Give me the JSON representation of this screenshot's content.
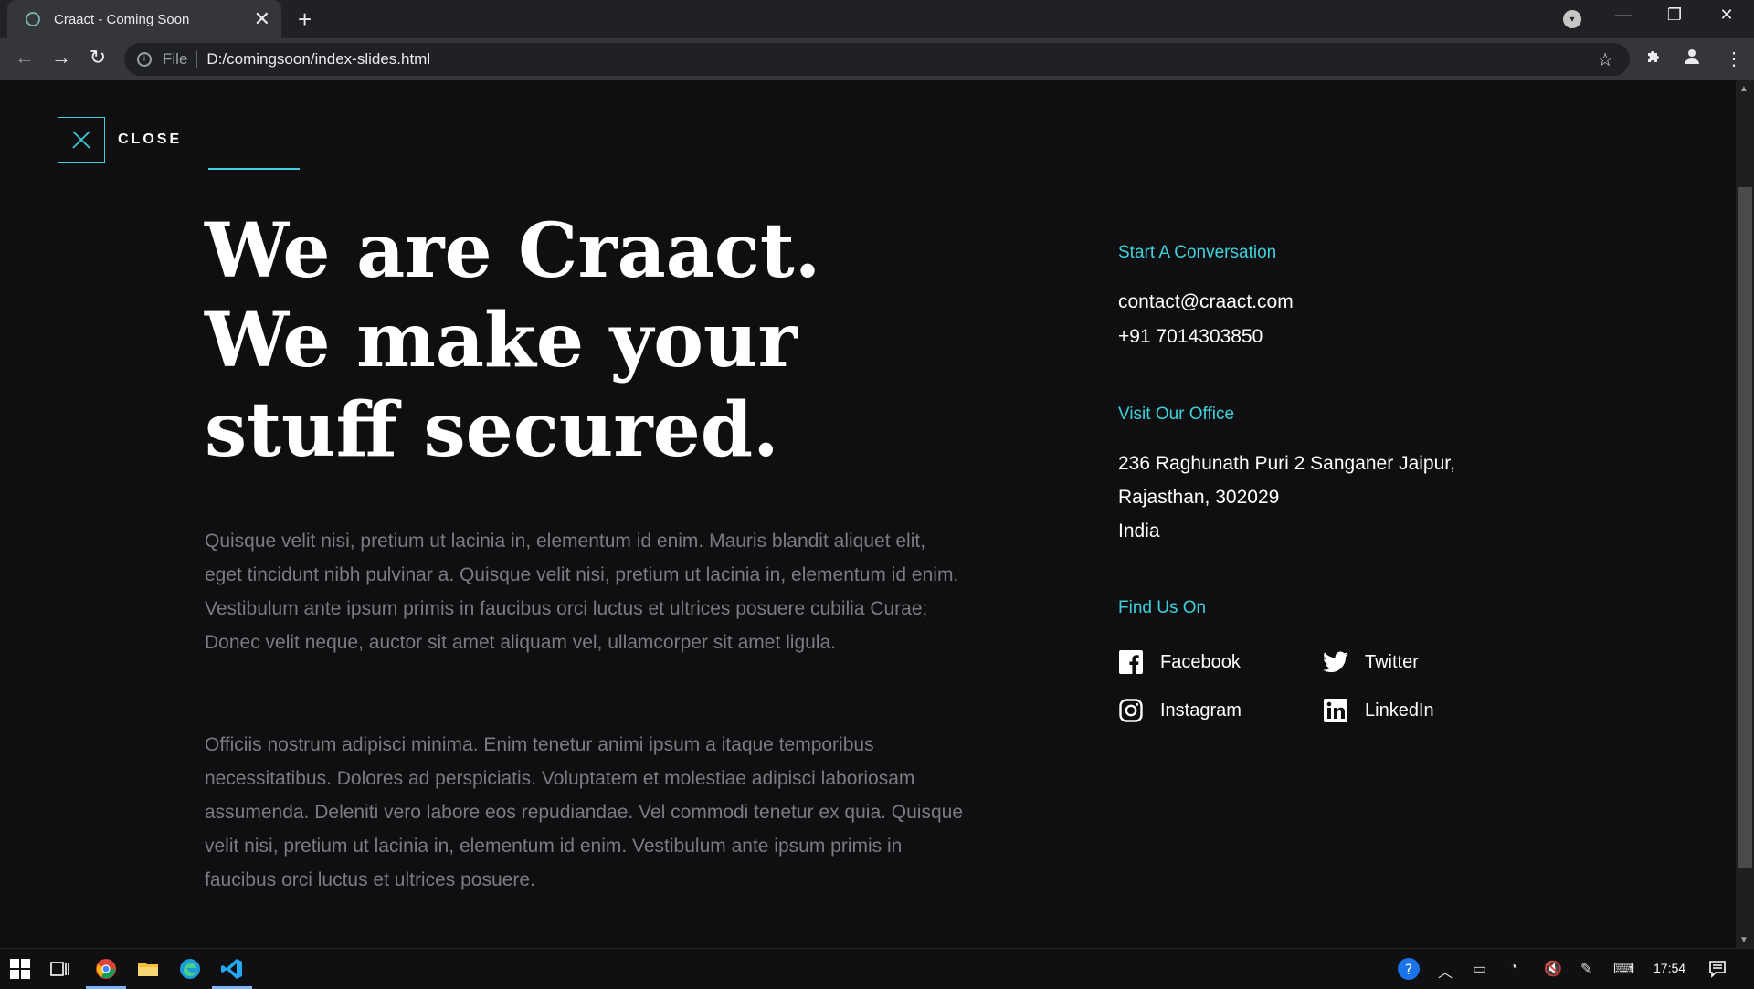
{
  "browser": {
    "tab_title": "Craact - Coming Soon",
    "tab_close": "✕",
    "new_tab": "+",
    "address_scheme": "File",
    "address_url": "D:/comingsoon/index-slides.html",
    "bookmark_icon": "☆",
    "extensions_icon": "puzzle-icon",
    "window": {
      "minimize": "—",
      "restore": "❐",
      "close": "✕"
    },
    "nav": {
      "back": "←",
      "forward": "→",
      "reload": "↻",
      "more": "⋮"
    }
  },
  "page": {
    "close_label": "CLOSE",
    "headline": "We are Craact. We make your stuff secured.",
    "paragraph_1": "Quisque velit nisi, pretium ut lacinia in, elementum id enim. Mauris blandit aliquet elit, eget tincidunt nibh pulvinar a. Quisque velit nisi, pretium ut lacinia in, elementum id enim. Vestibulum ante ipsum primis in faucibus orci luctus et ultrices posuere cubilia Curae; Donec velit neque, auctor sit amet aliquam vel, ullamcorper sit amet ligula.",
    "paragraph_2": "Officiis nostrum adipisci minima. Enim tenetur animi ipsum a itaque temporibus necessitatibus. Dolores ad perspiciatis. Voluptatem et molestiae adipisci laboriosam assumenda. Deleniti vero labore eos repudiandae. Vel commodi tenetur ex quia. Quisque velit nisi, pretium ut lacinia in, elementum id enim. Vestibulum ante ipsum primis in faucibus orci luctus et ultrices posuere.",
    "conversation": {
      "label": "Start A Conversation",
      "email": "contact@craact.com",
      "phone": "+91 7014303850"
    },
    "office": {
      "label": "Visit Our Office",
      "line1": "236 Raghunath Puri 2 Sanganer Jaipur,",
      "line2": "Rajasthan, 302029",
      "line3": "India"
    },
    "social": {
      "label": "Find Us On",
      "facebook": "Facebook",
      "twitter": "Twitter",
      "instagram": "Instagram",
      "linkedin": "LinkedIn"
    },
    "accent_color": "#3fd0db"
  },
  "taskbar": {
    "time": "17:54",
    "apps": [
      "windows-start-icon",
      "task-view-icon",
      "chrome-icon",
      "file-explorer-icon",
      "edge-icon",
      "vscode-icon"
    ]
  }
}
